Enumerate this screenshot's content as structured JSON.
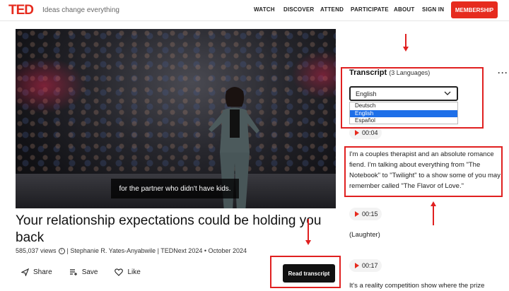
{
  "header": {
    "logo": "TED",
    "tagline": "Ideas change everything",
    "nav": [
      "WATCH",
      "DISCOVER",
      "ATTEND",
      "PARTICIPATE",
      "ABOUT",
      "SIGN IN"
    ],
    "membership": "MEMBERSHIP"
  },
  "video": {
    "subtitle": "for the partner who didn't have kids."
  },
  "talk": {
    "title": "Your relationship expectations could be holding you back",
    "views": "585,037 views",
    "speaker_event": "| Stephanie R. Yates-Anyabwile | TEDNext 2024 • October 2024"
  },
  "actions": {
    "share": "Share",
    "save": "Save",
    "like": "Like",
    "read_transcript": "Read transcript"
  },
  "transcript": {
    "heading": "Transcript",
    "languages_count": "(3 Languages)",
    "selected_language": "English",
    "options": [
      "Deutsch",
      "English",
      "Español"
    ],
    "entries": [
      {
        "time": "00:04",
        "text": "I'm a couples therapist and an absolute romance fiend. I'm talking about everything from \"The Notebook\" to \"Twilight\" to a show some of you may remember called \"The Flavor of Love.\""
      },
      {
        "time": "00:15",
        "text": "(Laughter)"
      },
      {
        "time": "00:17",
        "text": "It's a reality competition show where the prize"
      }
    ]
  },
  "colors": {
    "brand_red": "#e62b1e",
    "annotation_red": "#e02020",
    "selected_option": "#1e6fe8"
  }
}
